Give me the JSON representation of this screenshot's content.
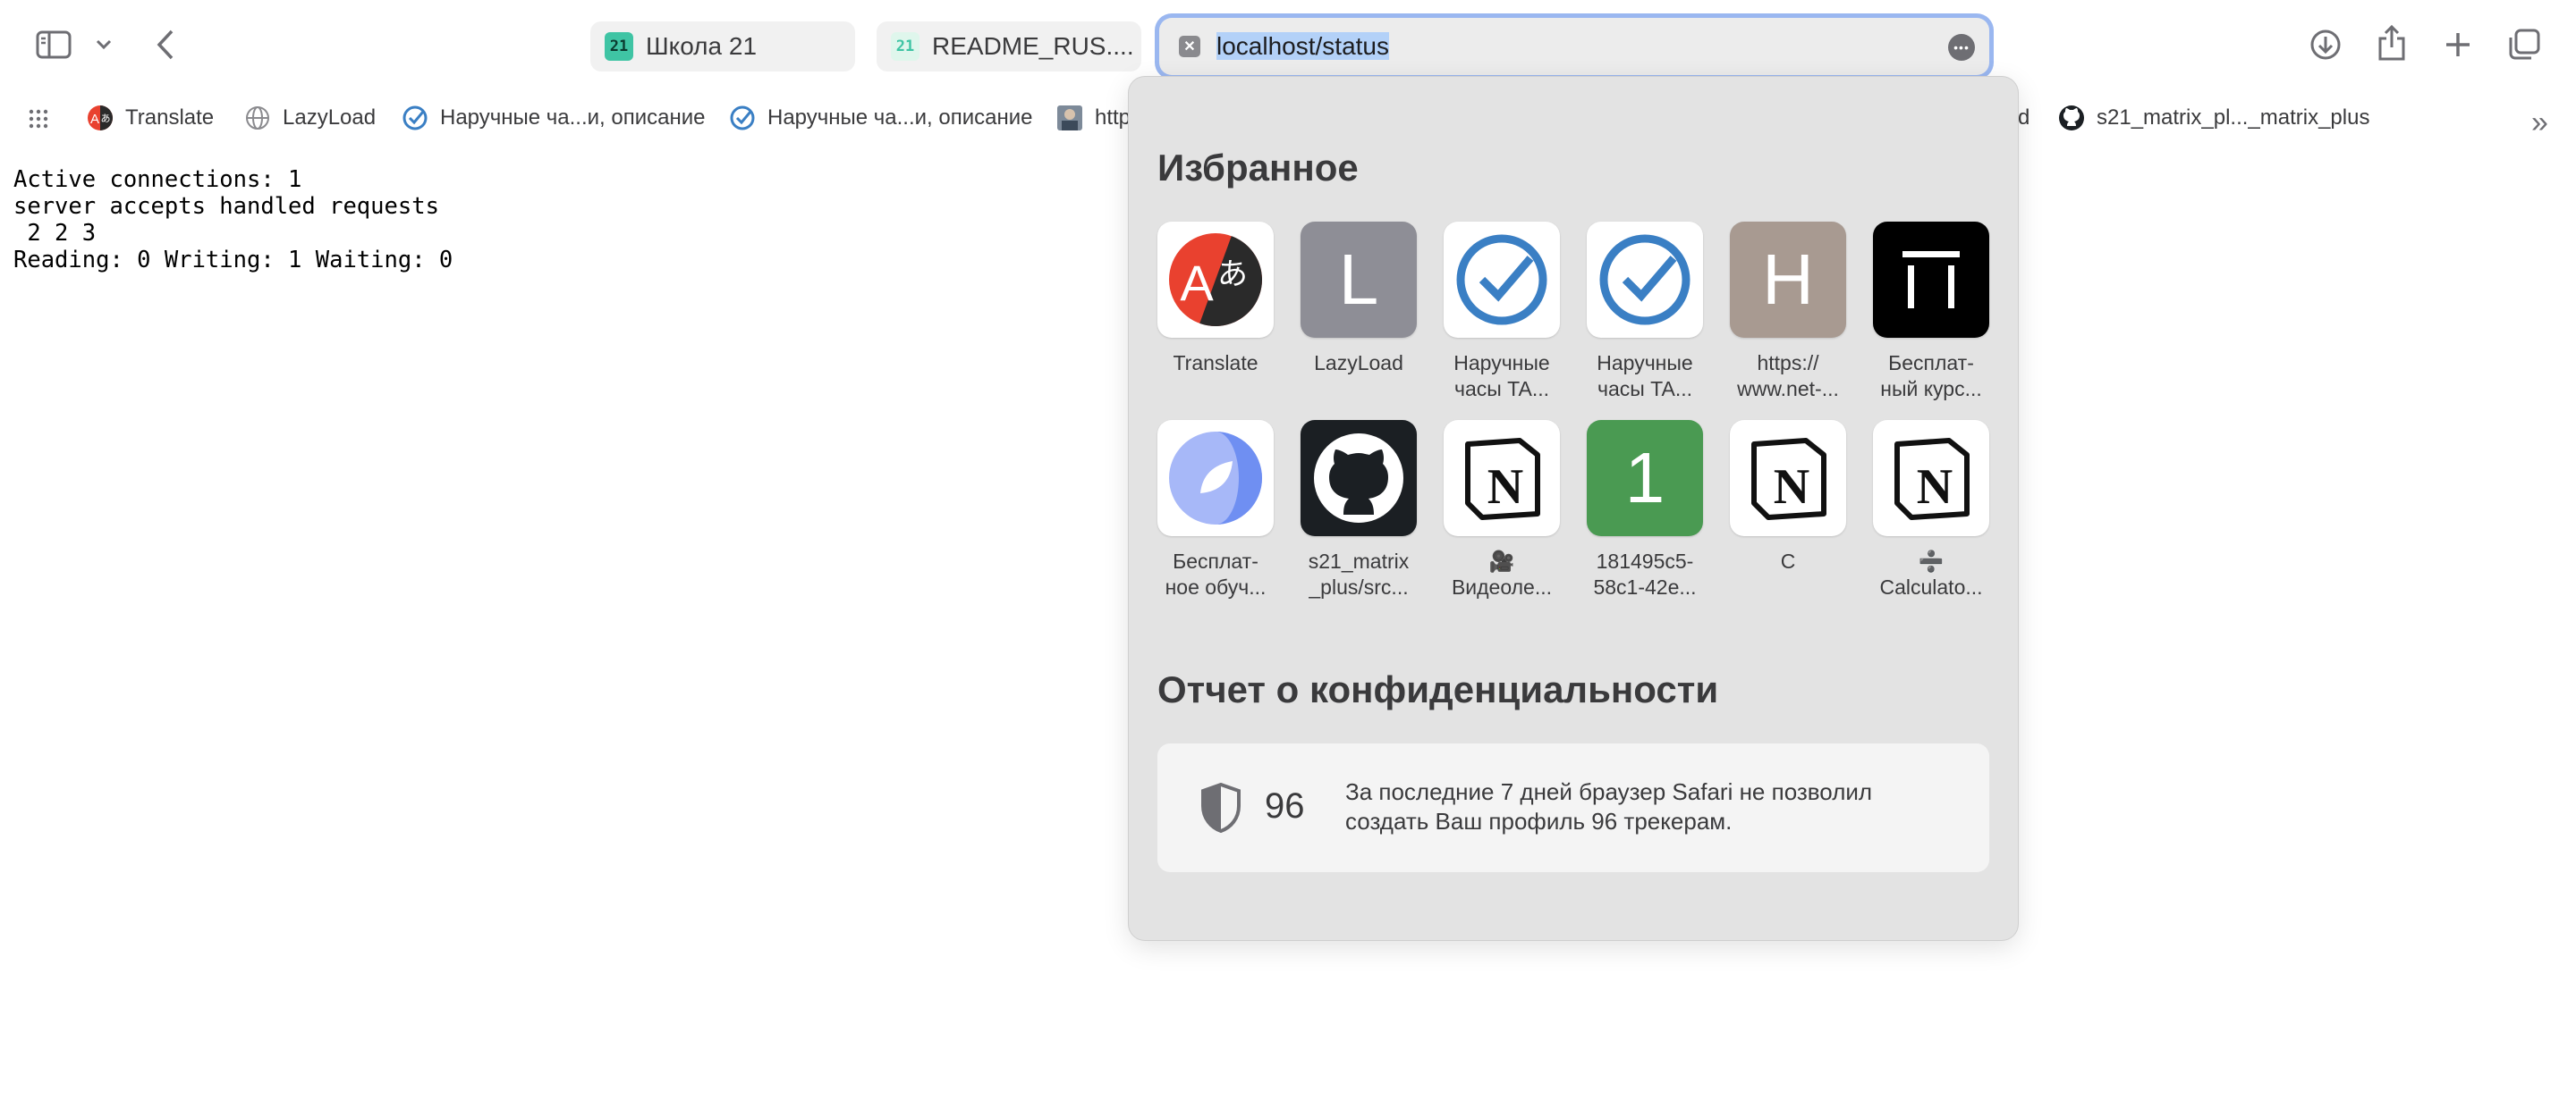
{
  "toolbar": {
    "tabs": [
      {
        "label": "Школа 21",
        "favicon": "school21-logo"
      },
      {
        "label": "README_RUS....",
        "favicon": "school21-logo-light"
      }
    ],
    "address": {
      "value": "localhost/status"
    },
    "icons": [
      "sidebar-icon",
      "chevron-down-icon",
      "back-icon",
      "download-icon",
      "share-icon",
      "plus-icon",
      "tabs-overview-icon",
      "more-icon",
      "clear-icon"
    ]
  },
  "favorites_bar": {
    "items": [
      {
        "label": "Translate",
        "icon": "translate-icon"
      },
      {
        "label": "LazyLoad",
        "icon": "globe-icon"
      },
      {
        "label": "Наручные ча...и, описание",
        "icon": "clock-icon"
      },
      {
        "label": "Наручные ча...и, описание",
        "icon": "clock-icon"
      },
      {
        "label": "http",
        "icon": "photo-icon"
      },
      {
        "label": "d",
        "icon": ""
      },
      {
        "label": "s21_matrix_pl..._matrix_plus",
        "icon": "github-icon"
      }
    ]
  },
  "page": {
    "lines": [
      "Active connections: 1",
      "server accepts handled requests",
      " 2 2 3",
      "Reading: 0 Writing: 1 Waiting: 0"
    ]
  },
  "popover": {
    "favorites_title": "Избранное",
    "favorites": [
      {
        "label": "Translate",
        "icon": "translate-icon"
      },
      {
        "label": "LazyLoad",
        "icon": "letter-L-icon",
        "letter": "L"
      },
      {
        "label": "Наручные\nчасы TA...",
        "icon": "clock-icon"
      },
      {
        "label": "Наручные\nчасы TA...",
        "icon": "clock-icon"
      },
      {
        "label": "https://\nwww.net-...",
        "icon": "letter-H-icon",
        "letter": "H"
      },
      {
        "label": "Бесплат-\nный курс...",
        "icon": "course-icon"
      },
      {
        "label": "Бесплат-\nное обуч...",
        "icon": "leaf-icon"
      },
      {
        "label": "s21_matrix\n_plus/src...",
        "icon": "github-icon"
      },
      {
        "label": "🎥\nВидеоле...",
        "icon": "notion-icon"
      },
      {
        "label": "181495c5-\n58c1-42e...",
        "icon": "letter-1-icon",
        "letter": "1"
      },
      {
        "label": "C",
        "icon": "notion-icon"
      },
      {
        "label": "➗\nCalculato...",
        "icon": "notion-icon"
      }
    ],
    "privacy_title": "Отчет о конфиденциальности",
    "privacy": {
      "count": "96",
      "text": "За последние 7 дней браузер Safari не позволил создать Ваш профиль 96 трекерам."
    }
  },
  "colors": {
    "address_focus_ring": "#9ab7f0",
    "selection": "#b3d1f8",
    "popover_bg": "#e3e3e3",
    "lazyload_tile": "#8e8e96",
    "https_tile": "#a89a91",
    "green_tile": "#4a9a52",
    "clock_blue": "#3a7fc4"
  }
}
